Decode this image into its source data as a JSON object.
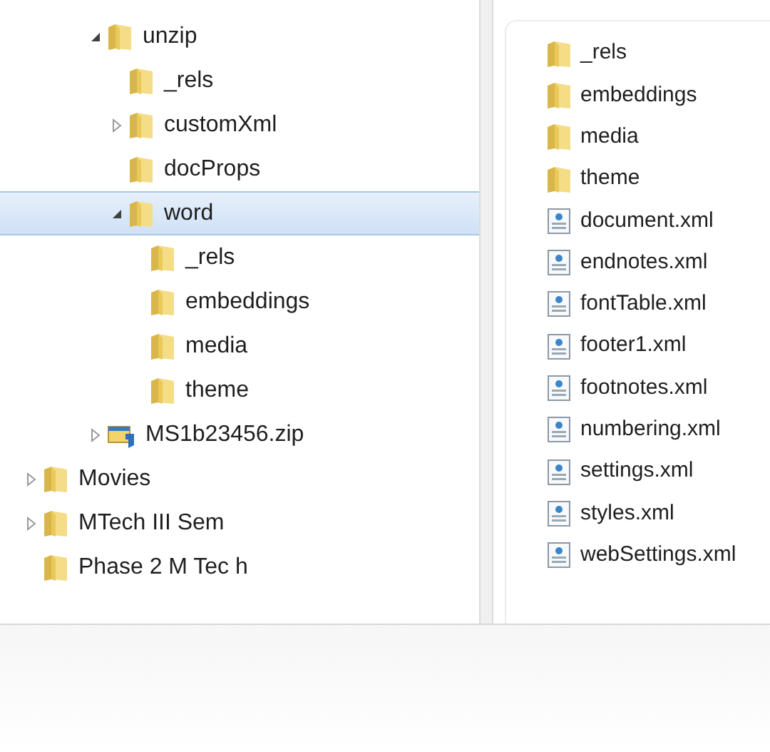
{
  "navigation_tree": [
    {
      "children": [
        {
          "children": [
            {
              "children": [
                {
                  "label": "unzip",
                  "kind": "folder",
                  "expanded": true,
                  "selected": false,
                  "children": [
                    {
                      "label": "_rels",
                      "kind": "folder",
                      "selected": false
                    },
                    {
                      "label": "customXml",
                      "kind": "folder",
                      "expanded": false,
                      "selected": false
                    },
                    {
                      "label": "docProps",
                      "kind": "folder",
                      "selected": false
                    },
                    {
                      "label": "word",
                      "kind": "folder",
                      "expanded": true,
                      "selected": true,
                      "children": [
                        {
                          "label": "_rels",
                          "kind": "folder",
                          "selected": false
                        },
                        {
                          "label": "embeddings",
                          "kind": "folder",
                          "selected": false
                        },
                        {
                          "label": "media",
                          "kind": "folder",
                          "selected": false
                        },
                        {
                          "label": "theme",
                          "kind": "folder",
                          "selected": false
                        }
                      ]
                    }
                  ]
                },
                {
                  "label": "MS1b23456.zip",
                  "kind": "zip",
                  "expanded": false,
                  "selected": false
                }
              ]
            }
          ]
        }
      ]
    },
    {
      "label": "Movies",
      "kind": "folder",
      "expanded": false,
      "selected": false
    },
    {
      "label": "MTech III Sem",
      "kind": "folder",
      "expanded": false,
      "selected": false
    },
    {
      "label": "Phase 2 M Tec h",
      "kind": "folder",
      "selected": false
    }
  ],
  "file_list": [
    {
      "label": "_rels",
      "kind": "folder"
    },
    {
      "label": "embeddings",
      "kind": "folder"
    },
    {
      "label": "media",
      "kind": "folder"
    },
    {
      "label": "theme",
      "kind": "folder"
    },
    {
      "label": "document.xml",
      "kind": "xml"
    },
    {
      "label": "endnotes.xml",
      "kind": "xml"
    },
    {
      "label": "fontTable.xml",
      "kind": "xml"
    },
    {
      "label": "footer1.xml",
      "kind": "xml"
    },
    {
      "label": "footnotes.xml",
      "kind": "xml"
    },
    {
      "label": "numbering.xml",
      "kind": "xml"
    },
    {
      "label": "settings.xml",
      "kind": "xml"
    },
    {
      "label": "styles.xml",
      "kind": "xml"
    },
    {
      "label": "webSettings.xml",
      "kind": "xml"
    }
  ]
}
